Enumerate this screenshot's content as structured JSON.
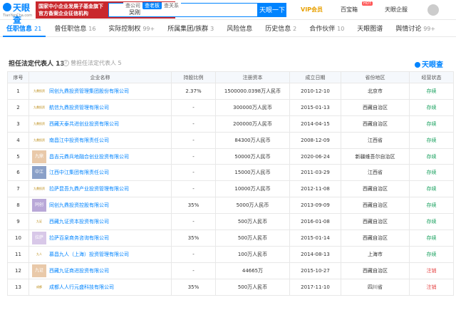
{
  "header": {
    "logo_text": "天眼查",
    "logo_sub": "TianYanCha.com",
    "banner_line1": "国家中小企业发展子基金旗下",
    "banner_line2": "官方备案企业征信机构",
    "search_tabs": [
      "查公司",
      "查老板",
      "查关系"
    ],
    "search_value": "吴刚",
    "search_button": "天眼一下",
    "vip": "VIP会员",
    "app_label": "百宝箱",
    "hot_badge": "HOT",
    "company_label": "天眼企服"
  },
  "tabs": [
    {
      "label": "任职信息",
      "count": "21"
    },
    {
      "label": "曾任职信息",
      "count": "16"
    },
    {
      "label": "实际控制权",
      "count": "99+"
    },
    {
      "label": "所属集团/族群",
      "count": "3"
    },
    {
      "label": "风险信息",
      "count": ""
    },
    {
      "label": "历史信息",
      "count": "2"
    },
    {
      "label": "合作伙伴",
      "count": "10"
    },
    {
      "label": "天眼图谱",
      "count": ""
    },
    {
      "label": "舆情讨论",
      "count": "99+"
    }
  ],
  "section": {
    "title": "担任法定代表人",
    "count": "13",
    "alt": "曾担任法定代表人 5",
    "watermark": "天眼查"
  },
  "table": {
    "columns": [
      "序号",
      "企业名称",
      "持股比例",
      "注册资本",
      "成立日期",
      "省份地区",
      "经营状态"
    ],
    "rows": [
      {
        "no": "1",
        "logo": "九鼎投资",
        "name": "同创九鼎投资管理集团股份有限公司",
        "share": "2.37%",
        "capital": "1500000.0398万人民币",
        "date": "2010-12-10",
        "region": "北京市",
        "status": "存续"
      },
      {
        "no": "2",
        "logo": "九鼎投资",
        "name": "航信九鼎投资管理有限公司",
        "share": "-",
        "capital": "300000万人民币",
        "date": "2015-01-13",
        "region": "西藏自治区",
        "status": "存续"
      },
      {
        "no": "3",
        "logo": "九鼎投资",
        "name": "西藏天泰共进创业投资有限公司",
        "share": "-",
        "capital": "200000万人民币",
        "date": "2014-04-15",
        "region": "西藏自治区",
        "status": "存续"
      },
      {
        "no": "4",
        "logo": "九鼎投资",
        "name": "南昌江中投资有限责任公司",
        "share": "-",
        "capital": "84300万人民币",
        "date": "2008-12-09",
        "region": "江西省",
        "status": "存续"
      },
      {
        "no": "5",
        "logo": "九鼎",
        "name": "昌吉元鼎兵地融合创业投资有限公司",
        "share": "-",
        "capital": "50000万人民币",
        "date": "2020-06-24",
        "region": "新疆维吾尔自治区",
        "status": "存续"
      },
      {
        "no": "6",
        "logo": "中江",
        "name": "江西中江集团有限责任公司",
        "share": "-",
        "capital": "15000万人民币",
        "date": "2011-03-29",
        "region": "江西省",
        "status": "存续"
      },
      {
        "no": "7",
        "logo": "九鼎投资",
        "name": "拉萨昆吾九鼎产业投资管理有限公司",
        "share": "-",
        "capital": "10000万人民币",
        "date": "2012-11-08",
        "region": "西藏自治区",
        "status": "存续"
      },
      {
        "no": "8",
        "logo": "同创",
        "name": "同创九鼎投资控股有限公司",
        "share": "35%",
        "capital": "5000万人民币",
        "date": "2013-09-09",
        "region": "西藏自治区",
        "status": "存续"
      },
      {
        "no": "9",
        "logo": "九证",
        "name": "西藏九证资本投资有限公司",
        "share": "-",
        "capital": "500万人民币",
        "date": "2016-01-08",
        "region": "西藏自治区",
        "status": "存续"
      },
      {
        "no": "10",
        "logo": "拉萨",
        "name": "拉萨百泉商务咨询有限公司",
        "share": "35%",
        "capital": "500万人民币",
        "date": "2015-01-14",
        "region": "西藏自治区",
        "status": "存续"
      },
      {
        "no": "11",
        "logo": "九人",
        "name": "慕昌九人（上海）投资管理有限公司",
        "share": "-",
        "capital": "100万人民币",
        "date": "2014-08-13",
        "region": "上海市",
        "status": "存续"
      },
      {
        "no": "12",
        "logo": "九证",
        "name": "西藏九证商进投资有限公司",
        "share": "-",
        "capital": "44665万",
        "date": "2015-10-27",
        "region": "西藏自治区",
        "status": "注销"
      },
      {
        "no": "13",
        "logo": "成都",
        "name": "成都人人行元盛科技有限公司",
        "share": "35%",
        "capital": "500万人民币",
        "date": "2017-11-10",
        "region": "四川省",
        "status": "注销"
      }
    ]
  },
  "colors": {
    "accent": "#0084ff",
    "ok": "#17a05d",
    "bad": "#e64545",
    "banner": "#c9282d"
  }
}
